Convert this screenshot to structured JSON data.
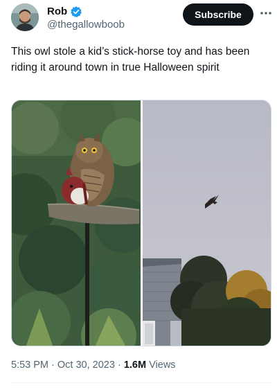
{
  "author": {
    "display_name": "Rob",
    "handle": "@thegallowboob",
    "verified": true
  },
  "actions": {
    "subscribe_label": "Subscribe",
    "more_icon": "more-horizontal-icon"
  },
  "tweet": {
    "text": "This owl stole a kid’s stick-horse toy and has been riding it around town in true Halloween spirit",
    "time": "5:53 PM",
    "date": "Oct 30, 2023",
    "separator": "·",
    "views_count": "1.6M",
    "views_label": "Views"
  },
  "colors": {
    "accent": "#1d9bf0",
    "text": "#0f1419",
    "muted": "#536471",
    "button_bg": "#0f1419"
  }
}
